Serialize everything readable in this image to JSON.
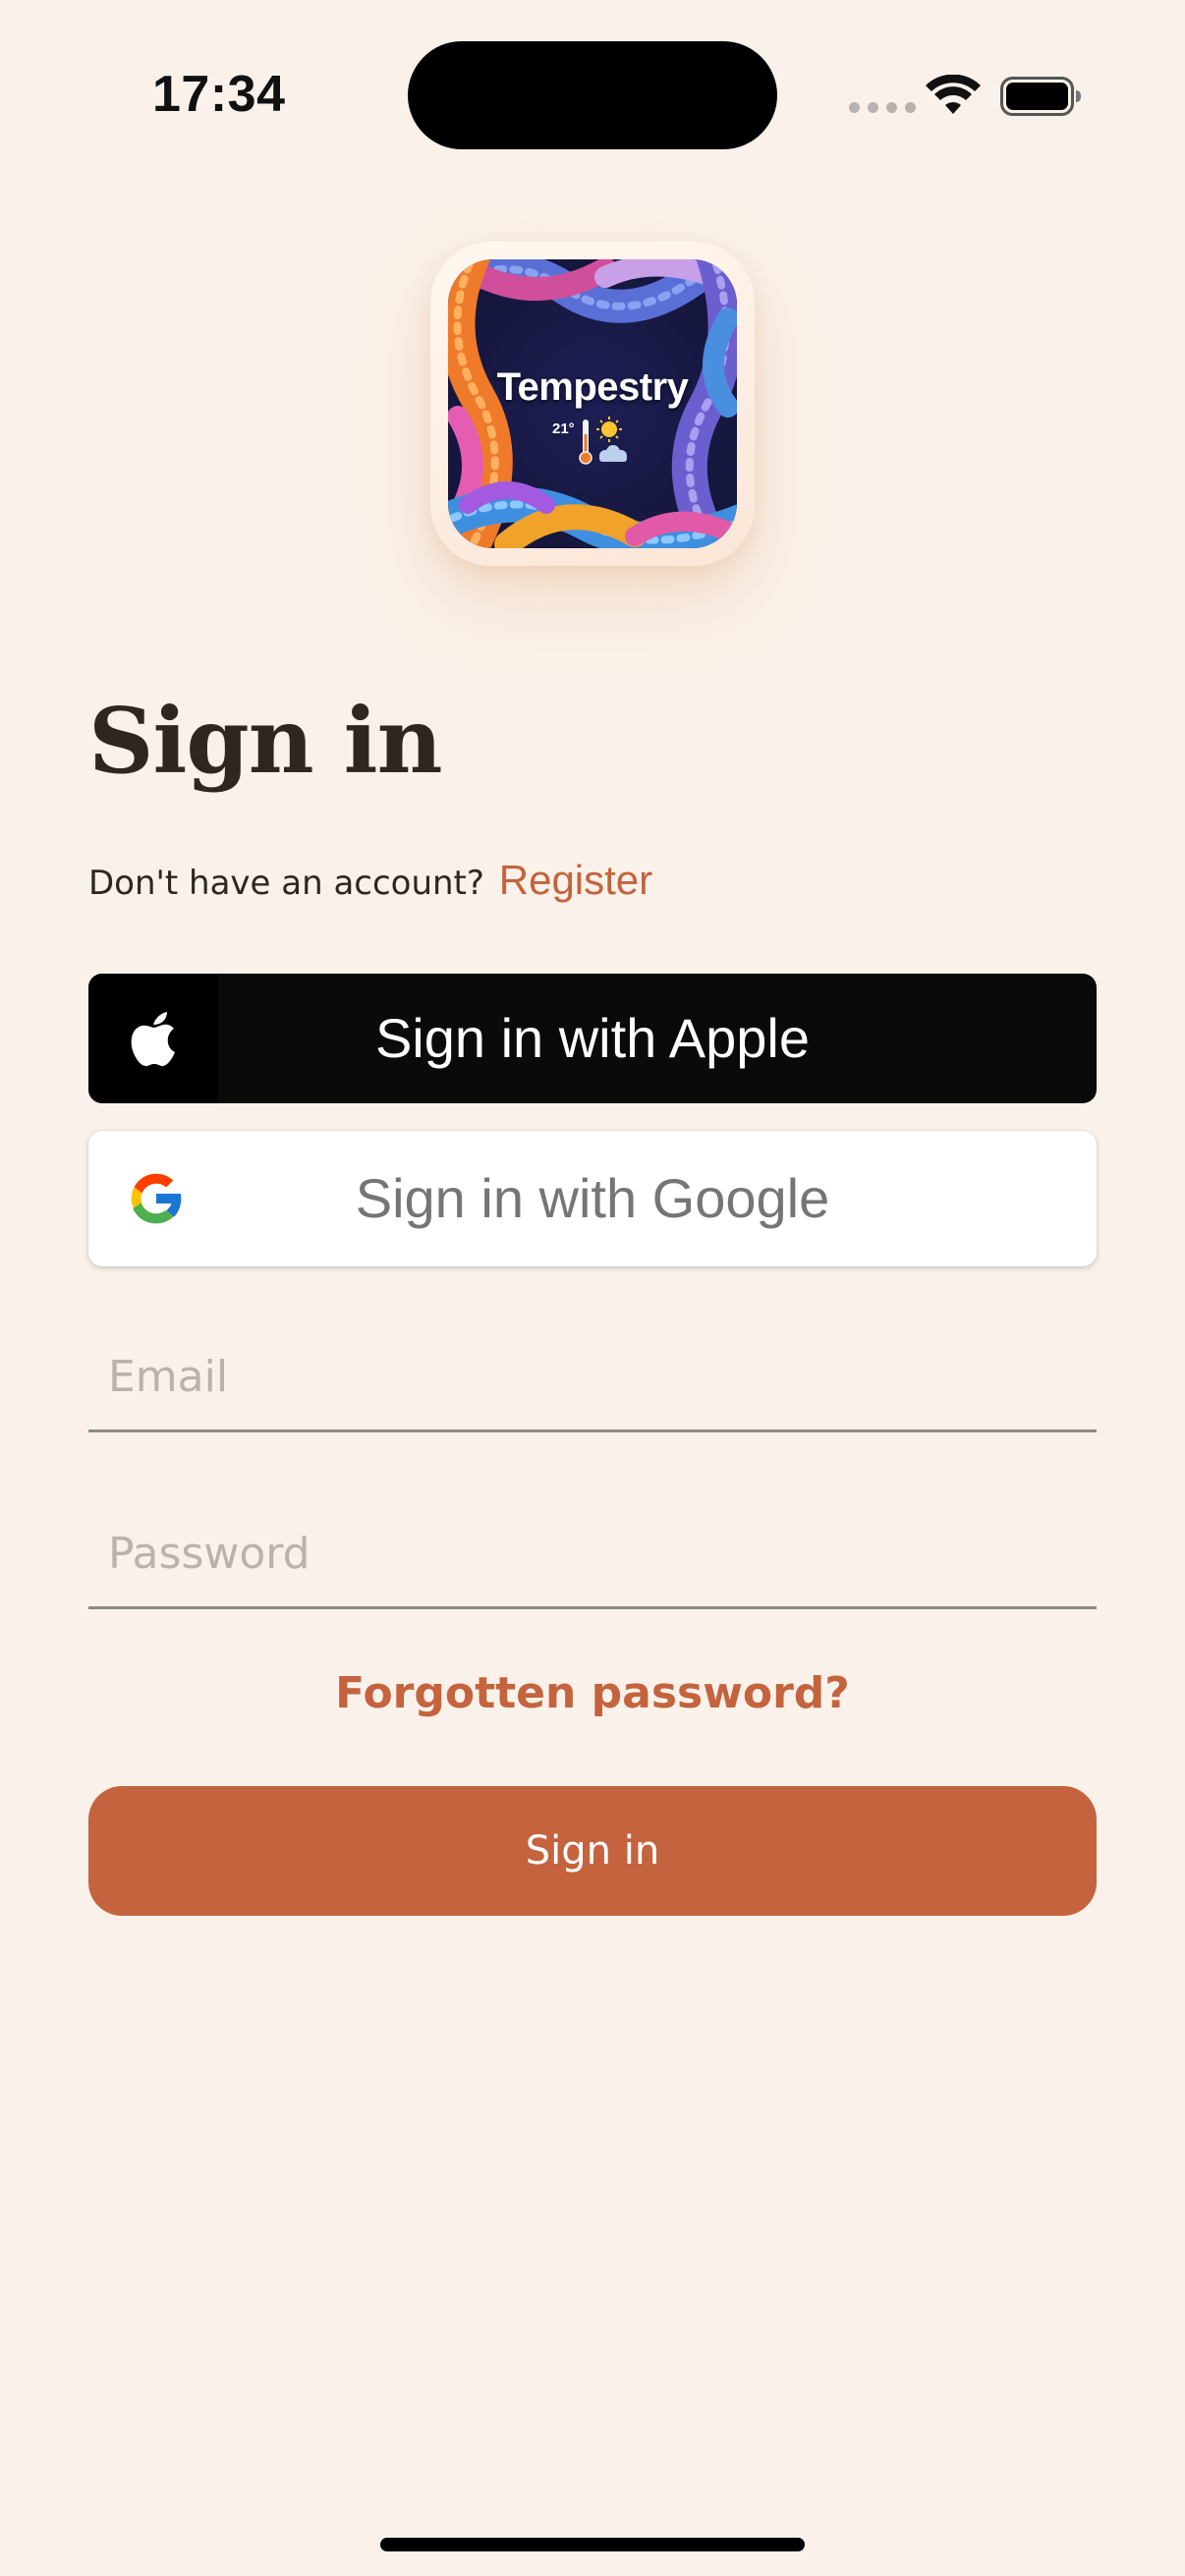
{
  "status_bar": {
    "time": "17:34"
  },
  "logo": {
    "title": "Tempestry",
    "temperature": "21°"
  },
  "heading": {
    "title": "Sign in"
  },
  "register": {
    "prompt": "Don't have an account?",
    "link": "Register"
  },
  "buttons": {
    "apple": "Sign in with Apple",
    "google": "Sign in with Google",
    "sign_in": "Sign in"
  },
  "form": {
    "email_placeholder": "Email",
    "email_value": "",
    "password_placeholder": "Password",
    "password_value": "",
    "forgot_password": "Forgotten password?"
  },
  "colors": {
    "background": "#faf2ea",
    "accent": "#c4633d",
    "text": "#2e2620",
    "apple_button": "#0a0a0b"
  },
  "icons": {
    "apple": "apple-logo-icon",
    "google": "google-logo-icon",
    "wifi": "wifi-icon",
    "battery": "battery-icon",
    "signal": "signal-dots-icon"
  }
}
